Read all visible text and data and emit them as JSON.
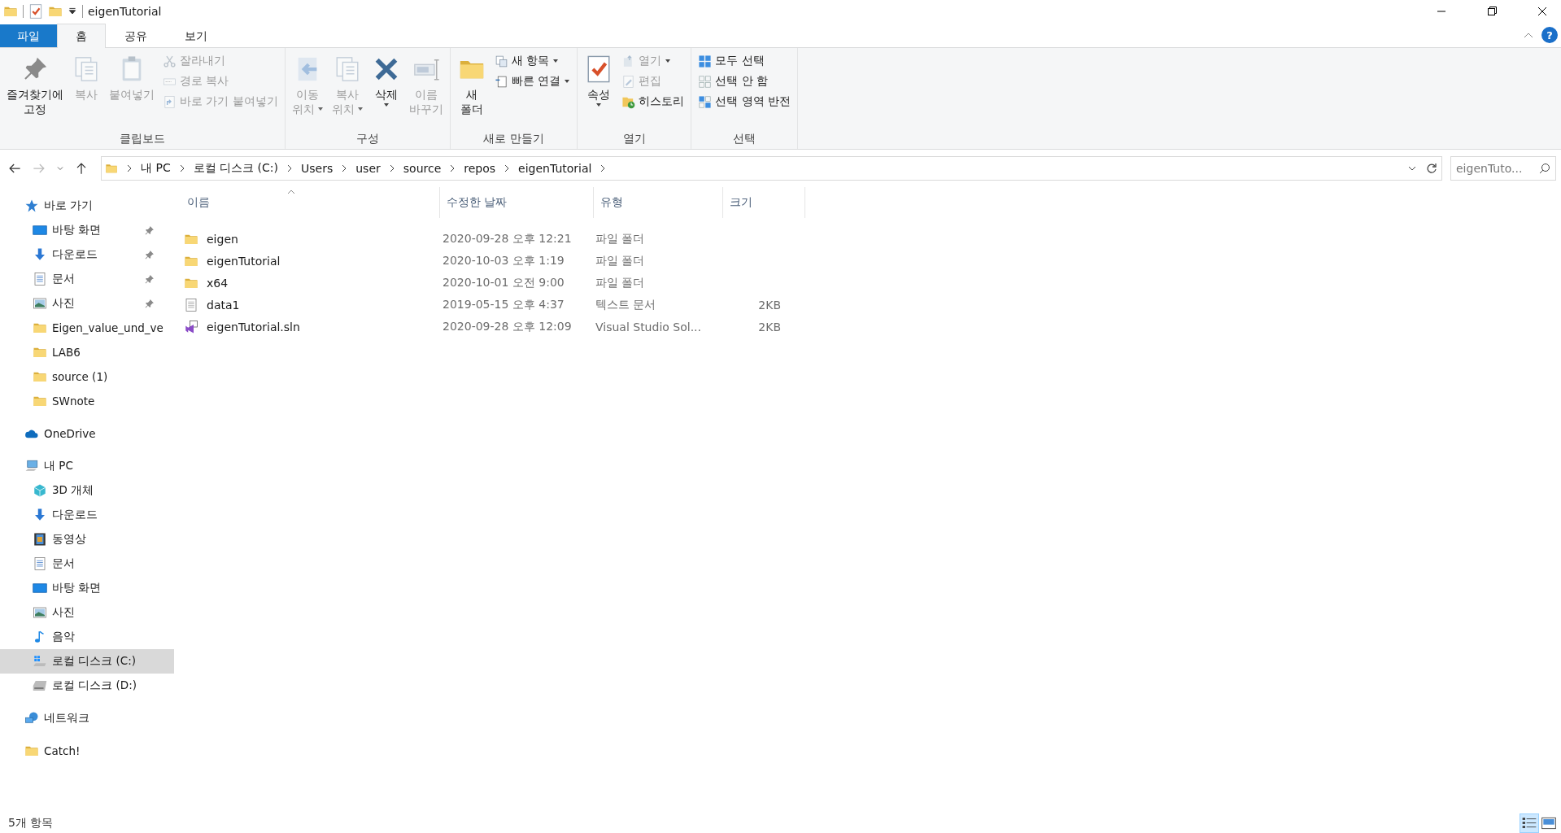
{
  "window": {
    "title": "eigenTutorial"
  },
  "ribbon_tabs": [
    {
      "label": "파일",
      "kind": "file",
      "selected": false
    },
    {
      "label": "홈",
      "kind": "tab",
      "selected": true
    },
    {
      "label": "공유",
      "kind": "tab",
      "selected": false
    },
    {
      "label": "보기",
      "kind": "tab",
      "selected": false
    }
  ],
  "help": "?",
  "ribbon_groups": [
    {
      "label": "클립보드",
      "commands": [
        {
          "kind": "large",
          "lines": [
            "즐겨찾기에",
            "고정"
          ],
          "disabled": false,
          "dropdown": false
        },
        {
          "kind": "large",
          "lines": [
            "복사"
          ],
          "disabled": true,
          "dropdown": false
        },
        {
          "kind": "large",
          "lines": [
            "붙여넣기"
          ],
          "disabled": true,
          "dropdown": false
        },
        {
          "kind": "small",
          "lines": [
            "잘라내기"
          ],
          "disabled": true,
          "dropdown": false
        },
        {
          "kind": "small",
          "lines": [
            "경로 복사"
          ],
          "disabled": true,
          "dropdown": false
        },
        {
          "kind": "small",
          "lines": [
            "바로 가기 붙여넣기"
          ],
          "disabled": true,
          "dropdown": false
        }
      ]
    },
    {
      "label": "구성",
      "commands": [
        {
          "kind": "large",
          "lines": [
            "이동",
            "위치"
          ],
          "disabled": true,
          "dropdown": true
        },
        {
          "kind": "large",
          "lines": [
            "복사",
            "위치"
          ],
          "disabled": true,
          "dropdown": true
        },
        {
          "kind": "large",
          "lines": [
            "삭제"
          ],
          "disabled": false,
          "dropdown": true
        },
        {
          "kind": "large",
          "lines": [
            "이름",
            "바꾸기"
          ],
          "disabled": true,
          "dropdown": false
        }
      ]
    },
    {
      "label": "새로 만들기",
      "commands": [
        {
          "kind": "large",
          "lines": [
            "새",
            "폴더"
          ],
          "disabled": false,
          "dropdown": false
        },
        {
          "kind": "small",
          "lines": [
            "새 항목"
          ],
          "disabled": false,
          "dropdown": true
        },
        {
          "kind": "small",
          "lines": [
            "빠른 연결"
          ],
          "disabled": false,
          "dropdown": true
        }
      ]
    },
    {
      "label": "열기",
      "commands": [
        {
          "kind": "large",
          "lines": [
            "속성"
          ],
          "disabled": false,
          "dropdown": true
        },
        {
          "kind": "small",
          "lines": [
            "열기"
          ],
          "disabled": true,
          "dropdown": true
        },
        {
          "kind": "small",
          "lines": [
            "편집"
          ],
          "disabled": true,
          "dropdown": false
        },
        {
          "kind": "small",
          "lines": [
            "히스토리"
          ],
          "disabled": false,
          "dropdown": false
        }
      ]
    },
    {
      "label": "선택",
      "commands": [
        {
          "kind": "small",
          "lines": [
            "모두 선택"
          ],
          "disabled": false,
          "dropdown": false
        },
        {
          "kind": "small",
          "lines": [
            "선택 안 함"
          ],
          "disabled": false,
          "dropdown": false
        },
        {
          "kind": "small",
          "lines": [
            "선택 영역 반전"
          ],
          "disabled": false,
          "dropdown": false
        }
      ]
    }
  ],
  "nav_buttons": [
    {
      "kind": "back",
      "disabled": false
    },
    {
      "kind": "forward",
      "disabled": true
    },
    {
      "kind": "recent",
      "disabled": false
    },
    {
      "kind": "up",
      "disabled": false
    }
  ],
  "address": {
    "crumbs": [
      "내 PC",
      "로컬 디스크 (C:)",
      "Users",
      "user",
      "source",
      "repos",
      "eigenTutorial"
    ]
  },
  "search": {
    "placeholder": "eigenTuto..."
  },
  "sidebar": {
    "items": [
      {
        "label": "바로 가기",
        "kind": "star",
        "selected": false,
        "children": [
          {
            "label": "바탕 화면",
            "kind": "desktop",
            "selected": false,
            "pinned": true
          },
          {
            "label": "다운로드",
            "kind": "download",
            "selected": false,
            "pinned": true
          },
          {
            "label": "문서",
            "kind": "document",
            "selected": false,
            "pinned": true
          },
          {
            "label": "사진",
            "kind": "pictures",
            "selected": false,
            "pinned": true
          },
          {
            "label": "Eigen_value_und_ve",
            "kind": "folder",
            "selected": false,
            "pinned": false
          },
          {
            "label": "LAB6",
            "kind": "folder",
            "selected": false,
            "pinned": false
          },
          {
            "label": "source (1)",
            "kind": "folder",
            "selected": false,
            "pinned": false
          },
          {
            "label": "SWnote",
            "kind": "folder",
            "selected": false,
            "pinned": false
          }
        ]
      },
      {
        "label": "OneDrive",
        "kind": "cloud",
        "selected": false
      },
      {
        "label": "내 PC",
        "kind": "pc",
        "selected": false,
        "children": [
          {
            "label": "3D 개체",
            "kind": "cube",
            "selected": false
          },
          {
            "label": "다운로드",
            "kind": "download",
            "selected": false
          },
          {
            "label": "동영상",
            "kind": "video",
            "selected": false
          },
          {
            "label": "문서",
            "kind": "document",
            "selected": false
          },
          {
            "label": "바탕 화면",
            "kind": "desktop",
            "selected": false
          },
          {
            "label": "사진",
            "kind": "pictures",
            "selected": false
          },
          {
            "label": "음악",
            "kind": "music",
            "selected": false
          },
          {
            "label": "로컬 디스크 (C:)",
            "kind": "drive-win",
            "selected": true
          },
          {
            "label": "로컬 디스크 (D:)",
            "kind": "drive",
            "selected": false
          }
        ]
      },
      {
        "label": "네트워크",
        "kind": "network",
        "selected": false
      },
      {
        "label": "Catch!",
        "kind": "folder",
        "selected": false
      }
    ]
  },
  "file_list": {
    "columns": [
      {
        "label": "이름",
        "sorted": true
      },
      {
        "label": "수정한 날짜",
        "sorted": false
      },
      {
        "label": "유형",
        "sorted": false
      },
      {
        "label": "크기",
        "sorted": false
      }
    ],
    "rows": [
      {
        "name": "eigen",
        "kind": "folder",
        "modified": "2020-09-28 오후 12:21",
        "type": "파일 폴더"
      },
      {
        "name": "eigenTutorial",
        "kind": "folder",
        "modified": "2020-10-03 오후 1:19",
        "type": "파일 폴더"
      },
      {
        "name": "x64",
        "kind": "folder",
        "modified": "2020-10-01 오전 9:00",
        "type": "파일 폴더"
      },
      {
        "name": "data1",
        "kind": "text",
        "modified": "2019-05-15 오후 4:37",
        "type": "텍스트 문서",
        "size": "2KB"
      },
      {
        "name": "eigenTutorial.sln",
        "kind": "solution",
        "modified": "2020-09-28 오후 12:09",
        "type": "Visual Studio Sol...",
        "size": "2KB"
      }
    ]
  },
  "status_bar": {
    "text": "5개 항목",
    "views": [
      {
        "kind": "details",
        "selected": true
      },
      {
        "kind": "large-icons",
        "selected": false
      }
    ]
  }
}
